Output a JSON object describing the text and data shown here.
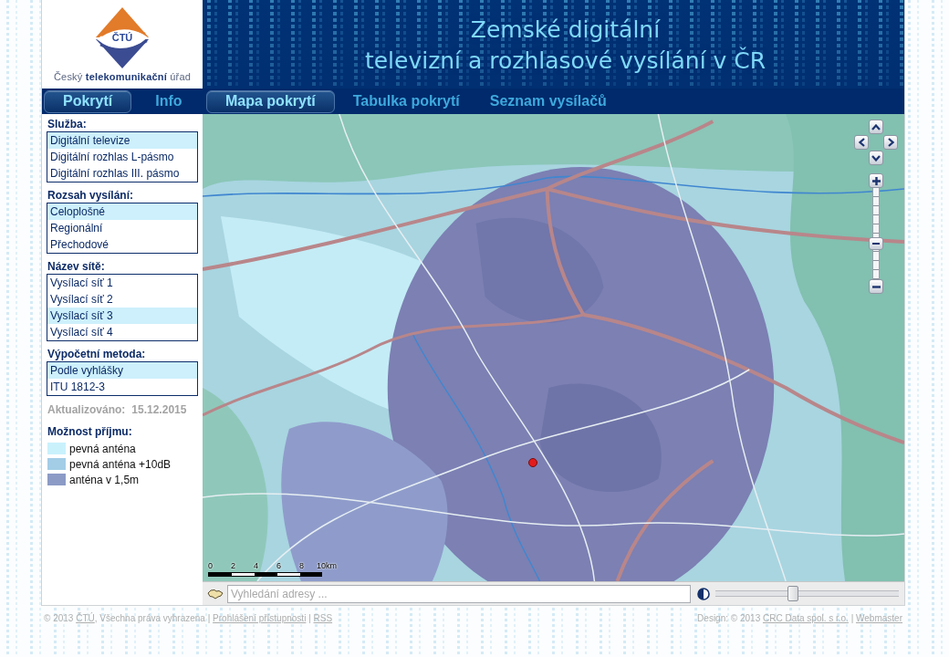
{
  "header": {
    "logo_mark": "ČTÚ",
    "logo_caption": "Český **telekomunikační** úřad",
    "title_lines": [
      "Zemské digitální",
      "televizní a rozhlasové vysílání v ČR"
    ]
  },
  "nav": {
    "sections": [
      {
        "label": "Pokrytí",
        "selected": true
      },
      {
        "label": "Info",
        "selected": false
      }
    ],
    "pages": [
      {
        "label": "Mapa pokrytí",
        "selected": true
      },
      {
        "label": "Tabulka pokrytí",
        "selected": false
      },
      {
        "label": "Seznam vysílačů",
        "selected": false
      }
    ]
  },
  "sidebar": {
    "filters": [
      {
        "title": "Služba:",
        "options": [
          {
            "label": "Digitální televize",
            "selected": true
          },
          {
            "label": "Digitální rozhlas L-pásmo",
            "selected": false
          },
          {
            "label": "Digitální rozhlas III. pásmo",
            "selected": false
          }
        ]
      },
      {
        "title": "Rozsah vysílání:",
        "options": [
          {
            "label": "Celoplošné",
            "selected": true
          },
          {
            "label": "Regionální",
            "selected": false
          },
          {
            "label": "Přechodové",
            "selected": false
          }
        ]
      },
      {
        "title": "Název sítě:",
        "options": [
          {
            "label": "Vysílací síť 1",
            "selected": false
          },
          {
            "label": "Vysílací síť 2",
            "selected": false
          },
          {
            "label": "Vysílací síť 3",
            "selected": true
          },
          {
            "label": "Vysílací síť 4",
            "selected": false
          }
        ]
      },
      {
        "title": "Výpočetní metoda:",
        "options": [
          {
            "label": "Podle vyhlášky",
            "selected": true
          },
          {
            "label": "ITU 1812-3",
            "selected": false
          }
        ]
      }
    ],
    "updated": {
      "label": "Aktualizováno:",
      "value": "15.12.2015"
    },
    "legend": {
      "title": "Možnost příjmu:",
      "items": [
        {
          "label": "pevná anténa",
          "color": "#c9f1fc"
        },
        {
          "label": "pevná anténa +10dB",
          "color": "#a3cde6"
        },
        {
          "label": "anténa v 1,5m",
          "color": "#8c9bc6"
        }
      ]
    }
  },
  "map": {
    "zoom": {
      "level": 0.37
    },
    "scale": {
      "labels": [
        "0",
        "2",
        "4",
        "6",
        "8",
        "10km"
      ]
    }
  },
  "map_bar": {
    "search": {
      "placeholder": "Vyhledání adresy ..."
    },
    "opacity": {
      "level": 0.42
    }
  },
  "footer": {
    "left": [
      {
        "kind": "text",
        "text": "© 2013 "
      },
      {
        "kind": "link",
        "text": "ČTÚ"
      },
      {
        "kind": "text",
        "text": ", Všechna práva vyhrazena | "
      },
      {
        "kind": "link",
        "text": "Prohlášení přístupnosti"
      },
      {
        "kind": "text",
        "text": " | "
      },
      {
        "kind": "link",
        "text": "RSS"
      }
    ],
    "right": [
      {
        "kind": "text",
        "text": "Design: © 2013 "
      },
      {
        "kind": "link",
        "text": "CRC Data spol. s r.o."
      },
      {
        "kind": "text",
        "text": " | "
      },
      {
        "kind": "link",
        "text": "Webmaster"
      }
    ]
  }
}
